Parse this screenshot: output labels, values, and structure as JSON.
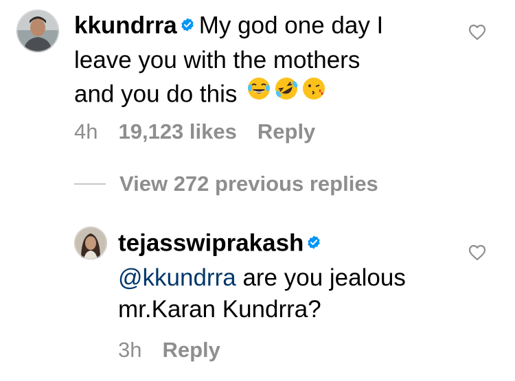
{
  "comment": {
    "username": "kkundrra",
    "text_part1": "My god one day I",
    "text_part2": "leave you with the mothers",
    "text_part3": "and you do this",
    "emojis": [
      "face-with-tears-of-joy",
      "rolling-on-floor-laughing",
      "face-blowing-kiss"
    ],
    "time": "4h",
    "likes": "19,123 likes",
    "reply_label": "Reply"
  },
  "view_replies": "View 272 previous replies",
  "reply": {
    "username": "tejasswiprakash",
    "mention": "@kkundrra",
    "text_rest": "are you jealous",
    "text_line2": "mr.Karan Kundrra?",
    "time": "3h",
    "reply_label": "Reply"
  },
  "colors": {
    "verified_blue": "#0095f6",
    "meta_gray": "#8e8e8e",
    "mention_blue": "#00376b"
  }
}
